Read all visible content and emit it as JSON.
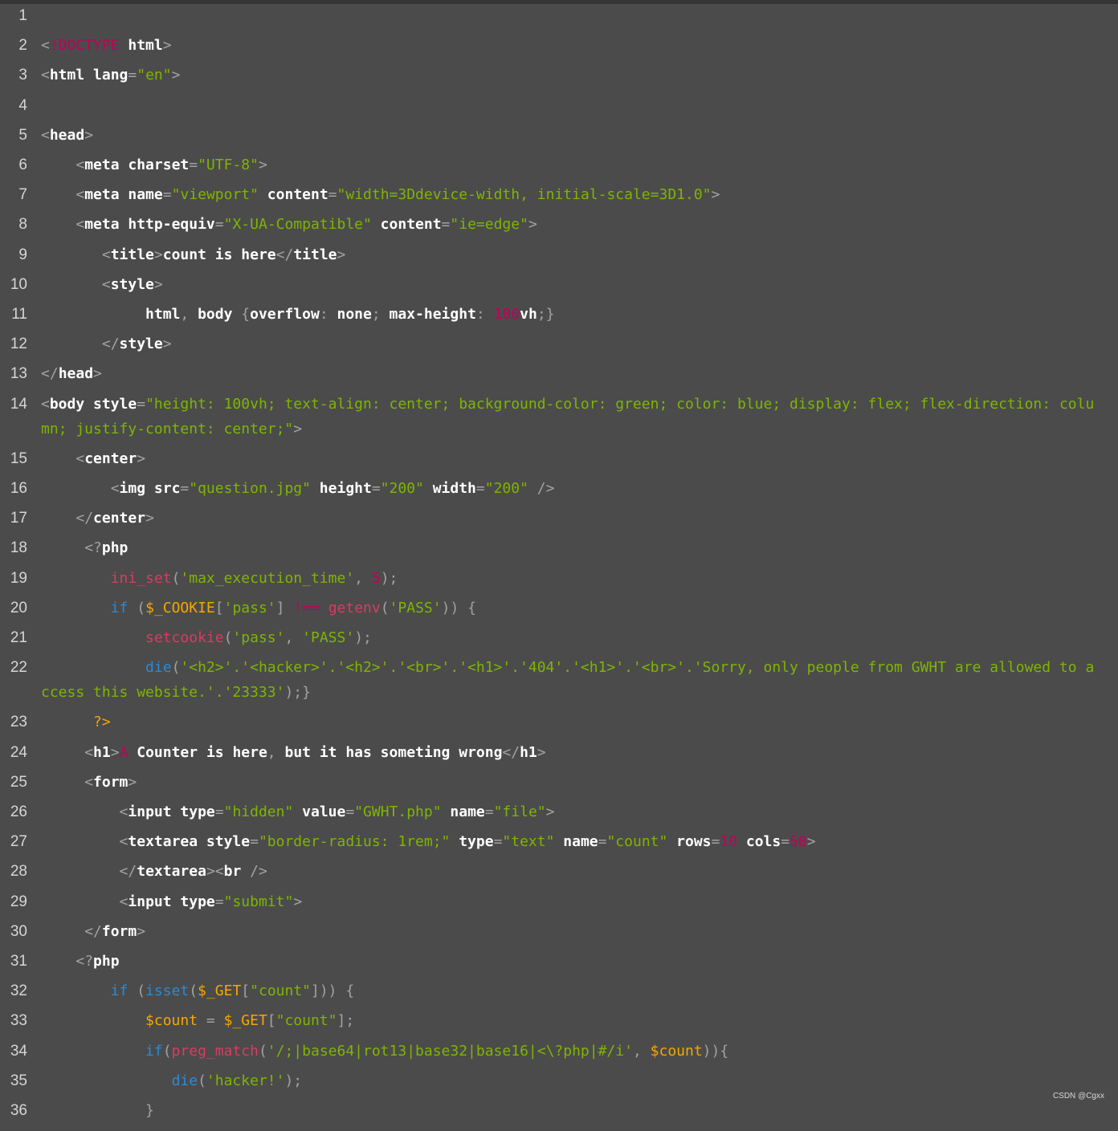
{
  "colors": {
    "background": "#4b4b4b",
    "text": "#ffffff",
    "punct": "#a2a2a2",
    "string": "#7fb500",
    "keyword": "#c2005a",
    "builtin": "#2a8bd6",
    "variable": "#f5a700",
    "function": "#d93b63",
    "line_number": "#d6d6d6"
  },
  "watermark": "CSDN @Cgxx",
  "lines": [
    {
      "n": "1",
      "indent": 0,
      "tokens": []
    },
    {
      "n": "2",
      "indent": 0,
      "tokens": [
        [
          "p",
          "<"
        ],
        [
          "k",
          "!DOCTYPE"
        ],
        [
          "t",
          " html"
        ],
        [
          "p",
          ">"
        ]
      ]
    },
    {
      "n": "3",
      "indent": 0,
      "tokens": [
        [
          "p",
          "<"
        ],
        [
          "t",
          "html lang"
        ],
        [
          "p",
          "="
        ],
        [
          "s",
          "\"en\""
        ],
        [
          "p",
          ">"
        ]
      ]
    },
    {
      "n": "4",
      "indent": 0,
      "tokens": []
    },
    {
      "n": "5",
      "indent": 0,
      "tokens": [
        [
          "p",
          "<"
        ],
        [
          "t",
          "head"
        ],
        [
          "p",
          ">"
        ]
      ]
    },
    {
      "n": "6",
      "indent": 4,
      "tokens": [
        [
          "p",
          "<"
        ],
        [
          "t",
          "meta charset"
        ],
        [
          "p",
          "="
        ],
        [
          "s",
          "\"UTF-8\""
        ],
        [
          "p",
          ">"
        ]
      ]
    },
    {
      "n": "7",
      "indent": 4,
      "tokens": [
        [
          "p",
          "<"
        ],
        [
          "t",
          "meta name"
        ],
        [
          "p",
          "="
        ],
        [
          "s",
          "\"viewport\""
        ],
        [
          "t",
          " content"
        ],
        [
          "p",
          "="
        ],
        [
          "s",
          "\"width=3Ddevice-width, initial-scale=3D1.0\""
        ],
        [
          "p",
          ">"
        ]
      ]
    },
    {
      "n": "8",
      "indent": 4,
      "tokens": [
        [
          "p",
          "<"
        ],
        [
          "t",
          "meta http-equiv"
        ],
        [
          "p",
          "="
        ],
        [
          "s",
          "\"X-UA-Compatible\""
        ],
        [
          "t",
          " content"
        ],
        [
          "p",
          "="
        ],
        [
          "s",
          "\"ie=edge\""
        ],
        [
          "p",
          ">"
        ]
      ]
    },
    {
      "n": "9",
      "indent": 7,
      "tokens": [
        [
          "p",
          "<"
        ],
        [
          "t",
          "title"
        ],
        [
          "p",
          ">"
        ],
        [
          "t",
          "count is here"
        ],
        [
          "p",
          "</"
        ],
        [
          "t",
          "title"
        ],
        [
          "p",
          ">"
        ]
      ]
    },
    {
      "n": "10",
      "indent": 7,
      "tokens": [
        [
          "p",
          "<"
        ],
        [
          "t",
          "style"
        ],
        [
          "p",
          ">"
        ]
      ]
    },
    {
      "n": "11",
      "indent": 12,
      "tokens": [
        [
          "t",
          "html"
        ],
        [
          "p",
          ","
        ],
        [
          "t",
          " body "
        ],
        [
          "p",
          "{"
        ],
        [
          "t",
          "overflow"
        ],
        [
          "p",
          ":"
        ],
        [
          "t",
          " none"
        ],
        [
          "p",
          ";"
        ],
        [
          "t",
          " max-height"
        ],
        [
          "p",
          ":"
        ],
        [
          "t",
          " "
        ],
        [
          "k",
          "100"
        ],
        [
          "t",
          "vh"
        ],
        [
          "p",
          ";}"
        ]
      ]
    },
    {
      "n": "12",
      "indent": 7,
      "tokens": [
        [
          "p",
          "</"
        ],
        [
          "t",
          "style"
        ],
        [
          "p",
          ">"
        ]
      ]
    },
    {
      "n": "13",
      "indent": 0,
      "tokens": [
        [
          "p",
          "</"
        ],
        [
          "t",
          "head"
        ],
        [
          "p",
          ">"
        ]
      ]
    },
    {
      "n": "14",
      "indent": 0,
      "wrap": true,
      "tokens": [
        [
          "p",
          "<"
        ],
        [
          "t",
          "body style"
        ],
        [
          "p",
          "="
        ],
        [
          "s",
          "\"height: 100vh; text-align: center; background-color: green; color: blue; display: flex; flex-direction: column; justify-content: center;\""
        ],
        [
          "p",
          ">"
        ]
      ]
    },
    {
      "n": "15",
      "indent": 4,
      "tokens": [
        [
          "p",
          "<"
        ],
        [
          "t",
          "center"
        ],
        [
          "p",
          ">"
        ]
      ]
    },
    {
      "n": "16",
      "indent": 8,
      "tokens": [
        [
          "p",
          "<"
        ],
        [
          "t",
          "img src"
        ],
        [
          "p",
          "="
        ],
        [
          "s",
          "\"question.jpg\""
        ],
        [
          "t",
          " height"
        ],
        [
          "p",
          "="
        ],
        [
          "s",
          "\"200\""
        ],
        [
          "t",
          " width"
        ],
        [
          "p",
          "="
        ],
        [
          "s",
          "\"200\""
        ],
        [
          "p",
          " />"
        ]
      ]
    },
    {
      "n": "17",
      "indent": 4,
      "tokens": [
        [
          "p",
          "</"
        ],
        [
          "t",
          "center"
        ],
        [
          "p",
          ">"
        ]
      ]
    },
    {
      "n": "18",
      "indent": 5,
      "tokens": [
        [
          "p",
          "<?"
        ],
        [
          "t",
          "php"
        ]
      ]
    },
    {
      "n": "19",
      "indent": 8,
      "tokens": [
        [
          "f",
          "ini_set"
        ],
        [
          "p",
          "("
        ],
        [
          "s",
          "'max_execution_time'"
        ],
        [
          "p",
          ", "
        ],
        [
          "k",
          "5"
        ],
        [
          "p",
          ");"
        ]
      ]
    },
    {
      "n": "20",
      "indent": 8,
      "tokens": [
        [
          "b",
          "if"
        ],
        [
          "p",
          " ("
        ],
        [
          "v",
          "$_COOKIE"
        ],
        [
          "p",
          "["
        ],
        [
          "s",
          "'pass'"
        ],
        [
          "p",
          "] "
        ],
        [
          "k",
          "!=="
        ],
        [
          "t",
          " "
        ],
        [
          "f",
          "getenv"
        ],
        [
          "p",
          "("
        ],
        [
          "s",
          "'PASS'"
        ],
        [
          "p",
          ")) {"
        ]
      ]
    },
    {
      "n": "21",
      "indent": 12,
      "tokens": [
        [
          "f",
          "setcookie"
        ],
        [
          "p",
          "("
        ],
        [
          "s",
          "'pass'"
        ],
        [
          "p",
          ", "
        ],
        [
          "s",
          "'PASS'"
        ],
        [
          "p",
          ");"
        ]
      ]
    },
    {
      "n": "22",
      "indent": 12,
      "wrap": true,
      "tokens": [
        [
          "b",
          "die"
        ],
        [
          "p",
          "("
        ],
        [
          "s",
          "'<h2>'.'<hacker>'.'<h2>'.'<br>'.'<h1>'.'404'.'<h1>'.'<br>'.'Sorry, only people from GWHT are allowed to access this website.'.'23333'"
        ],
        [
          "p",
          ");}"
        ]
      ]
    },
    {
      "n": "23",
      "indent": 6,
      "tokens": [
        [
          "v",
          "?>"
        ]
      ]
    },
    {
      "n": "24",
      "indent": 5,
      "tokens": [
        [
          "p",
          "<"
        ],
        [
          "t",
          "h1"
        ],
        [
          "p",
          ">"
        ],
        [
          "k",
          "A"
        ],
        [
          "t",
          " Counter is here"
        ],
        [
          "p",
          ","
        ],
        [
          "t",
          " but it has someting wrong"
        ],
        [
          "p",
          "</"
        ],
        [
          "t",
          "h1"
        ],
        [
          "p",
          ">"
        ]
      ]
    },
    {
      "n": "25",
      "indent": 5,
      "tokens": [
        [
          "p",
          "<"
        ],
        [
          "t",
          "form"
        ],
        [
          "p",
          ">"
        ]
      ]
    },
    {
      "n": "26",
      "indent": 9,
      "tokens": [
        [
          "p",
          "<"
        ],
        [
          "t",
          "input type"
        ],
        [
          "p",
          "="
        ],
        [
          "s",
          "\"hidden\""
        ],
        [
          "t",
          " value"
        ],
        [
          "p",
          "="
        ],
        [
          "s",
          "\"GWHT.php\""
        ],
        [
          "t",
          " name"
        ],
        [
          "p",
          "="
        ],
        [
          "s",
          "\"file\""
        ],
        [
          "p",
          ">"
        ]
      ]
    },
    {
      "n": "27",
      "indent": 9,
      "tokens": [
        [
          "p",
          "<"
        ],
        [
          "t",
          "textarea style"
        ],
        [
          "p",
          "="
        ],
        [
          "s",
          "\"border-radius: 1rem;\""
        ],
        [
          "t",
          " type"
        ],
        [
          "p",
          "="
        ],
        [
          "s",
          "\"text\""
        ],
        [
          "t",
          " name"
        ],
        [
          "p",
          "="
        ],
        [
          "s",
          "\"count\""
        ],
        [
          "t",
          " rows"
        ],
        [
          "p",
          "="
        ],
        [
          "k",
          "10"
        ],
        [
          "t",
          " cols"
        ],
        [
          "p",
          "="
        ],
        [
          "k",
          "50"
        ],
        [
          "p",
          ">"
        ]
      ]
    },
    {
      "n": "28",
      "indent": 9,
      "tokens": [
        [
          "p",
          "</"
        ],
        [
          "t",
          "textarea"
        ],
        [
          "p",
          "><"
        ],
        [
          "t",
          "br"
        ],
        [
          "p",
          " />"
        ]
      ]
    },
    {
      "n": "29",
      "indent": 9,
      "tokens": [
        [
          "p",
          "<"
        ],
        [
          "t",
          "input type"
        ],
        [
          "p",
          "="
        ],
        [
          "s",
          "\"submit\""
        ],
        [
          "p",
          ">"
        ]
      ]
    },
    {
      "n": "30",
      "indent": 5,
      "tokens": [
        [
          "p",
          "</"
        ],
        [
          "t",
          "form"
        ],
        [
          "p",
          ">"
        ]
      ]
    },
    {
      "n": "31",
      "indent": 4,
      "tokens": [
        [
          "p",
          "<?"
        ],
        [
          "t",
          "php"
        ]
      ]
    },
    {
      "n": "32",
      "indent": 8,
      "tokens": [
        [
          "b",
          "if"
        ],
        [
          "p",
          " ("
        ],
        [
          "b",
          "isset"
        ],
        [
          "p",
          "("
        ],
        [
          "v",
          "$_GET"
        ],
        [
          "p",
          "["
        ],
        [
          "s",
          "\"count\""
        ],
        [
          "p",
          "])) {"
        ]
      ]
    },
    {
      "n": "33",
      "indent": 12,
      "tokens": [
        [
          "v",
          "$count"
        ],
        [
          "p",
          " = "
        ],
        [
          "v",
          "$_GET"
        ],
        [
          "p",
          "["
        ],
        [
          "s",
          "\"count\""
        ],
        [
          "p",
          "];"
        ]
      ]
    },
    {
      "n": "34",
      "indent": 12,
      "tokens": [
        [
          "b",
          "if"
        ],
        [
          "p",
          "("
        ],
        [
          "f",
          "preg_match"
        ],
        [
          "p",
          "("
        ],
        [
          "s",
          "'/;|base64|rot13|base32|base16|<\\?php|#/i'"
        ],
        [
          "p",
          ", "
        ],
        [
          "v",
          "$count"
        ],
        [
          "p",
          "))"
        ],
        [
          "p",
          "{"
        ]
      ]
    },
    {
      "n": "35",
      "indent": 15,
      "tokens": [
        [
          "b",
          "die"
        ],
        [
          "p",
          "("
        ],
        [
          "s",
          "'hacker!'"
        ],
        [
          "p",
          ");"
        ]
      ]
    },
    {
      "n": "36",
      "indent": 12,
      "tokens": [
        [
          "p",
          "}"
        ]
      ]
    }
  ]
}
